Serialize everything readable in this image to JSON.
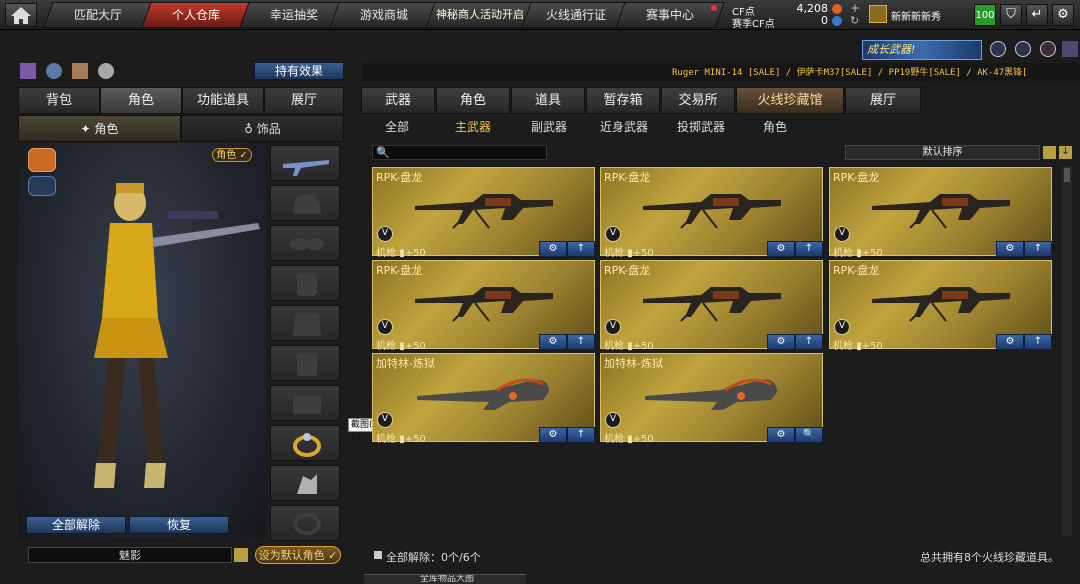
{
  "topnav": {
    "tabs": [
      "匹配大厅",
      "个人仓库",
      "幸运抽奖",
      "游戏商城",
      "神秘商人活动开启",
      "火线通行证",
      "赛事中心"
    ],
    "active_index": 1,
    "cf_label": "CF点",
    "cf_value": "4,208",
    "season_cf_label": "赛季CF点",
    "season_cf_value": "0",
    "username": "新新新新秀",
    "level": "100"
  },
  "banner": {
    "growth_weapon": "成长武器!"
  },
  "left": {
    "effect_button": "持有效果",
    "tabs": [
      "背包",
      "角色",
      "功能道具",
      "展厅"
    ],
    "active_tab": 1,
    "subtabs": [
      "角色",
      "饰品"
    ],
    "character_badge": "角色 ✓",
    "tooltip": "截图(Alt + A)",
    "clear_all": "全部解除",
    "restore": "恢复",
    "character_name": "魅影",
    "set_default": "设为默认角色 ✓"
  },
  "right": {
    "ticker": "Ruger MINI-14  [SALE] / 伊萨卡M37[SALE] / PP19野牛[SALE] / AK-47黑锋[",
    "tabs": [
      "武器",
      "角色",
      "道具",
      "暂存箱",
      "交易所",
      "火线珍藏馆",
      "展厅"
    ],
    "active_tab": 5,
    "subcategories": [
      "全部",
      "主武器",
      "副武器",
      "近身武器",
      "投掷武器",
      "角色"
    ],
    "active_subcategory": 1,
    "sort_label": "默认排序",
    "items": [
      {
        "name": "RPK-盘龙",
        "category": "机枪",
        "bonus": "▮+50",
        "btn2": "↑"
      },
      {
        "name": "RPK-盘龙",
        "category": "机枪",
        "bonus": "▮+50",
        "btn2": "↑"
      },
      {
        "name": "RPK-盘龙",
        "category": "机枪",
        "bonus": "▮+50",
        "btn2": "↑"
      },
      {
        "name": "RPK-盘龙",
        "category": "机枪",
        "bonus": "▮+50",
        "btn2": "↑"
      },
      {
        "name": "RPK-盘龙",
        "category": "机枪",
        "bonus": "▮+50",
        "btn2": "↑"
      },
      {
        "name": "RPK-盘龙",
        "category": "机枪",
        "bonus": "▮+50",
        "btn2": "↑"
      },
      {
        "name": "加特林-炼狱",
        "category": "机枪",
        "bonus": "▮+50",
        "btn2": "↑"
      },
      {
        "name": "加特林-炼狱",
        "category": "机枪",
        "bonus": "▮+50",
        "btn2": "🔍"
      }
    ],
    "clear_all_status": "全部解除：0个/6个",
    "total_owned": "总共拥有8个火线珍藏道具。",
    "bottom_partial": "全库物品大图"
  },
  "colors": {
    "accent_red": "#c13a2a",
    "card_gold": "#c1a43e",
    "button_blue": "#3b5f93",
    "highlight_yellow": "#f6c244"
  }
}
